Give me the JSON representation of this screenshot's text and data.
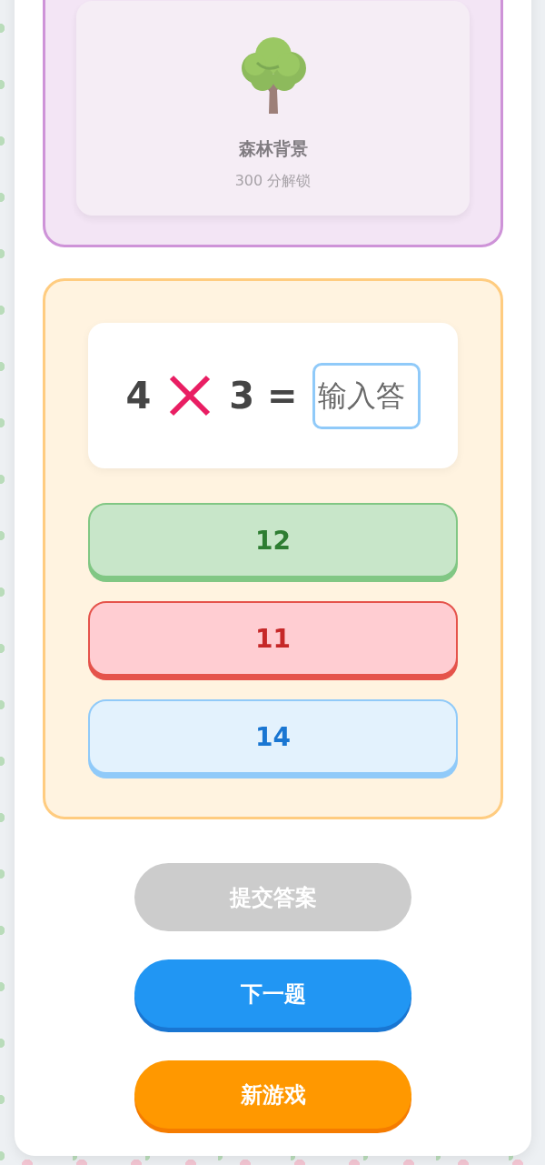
{
  "shop": {
    "item": {
      "title": "森林背景",
      "price": "300 分解锁",
      "locked": true
    }
  },
  "quiz": {
    "terms": [
      {
        "kind": "number",
        "text": "4"
      },
      {
        "kind": "multiply"
      },
      {
        "kind": "number",
        "text": "3"
      },
      {
        "kind": "equals",
        "text": "="
      }
    ],
    "answer": {
      "placeholder": "输入答"
    },
    "options": [
      {
        "label": "12",
        "kind": "correct"
      },
      {
        "label": "11",
        "kind": "wrong"
      },
      {
        "label": "14",
        "kind": "plain"
      }
    ]
  },
  "actions": [
    {
      "label": "提交答案",
      "kind": "submit",
      "disabled": true
    },
    {
      "label": "下一题",
      "kind": "next",
      "disabled": false
    },
    {
      "label": "新游戏",
      "kind": "new_game",
      "disabled": false
    }
  ]
}
